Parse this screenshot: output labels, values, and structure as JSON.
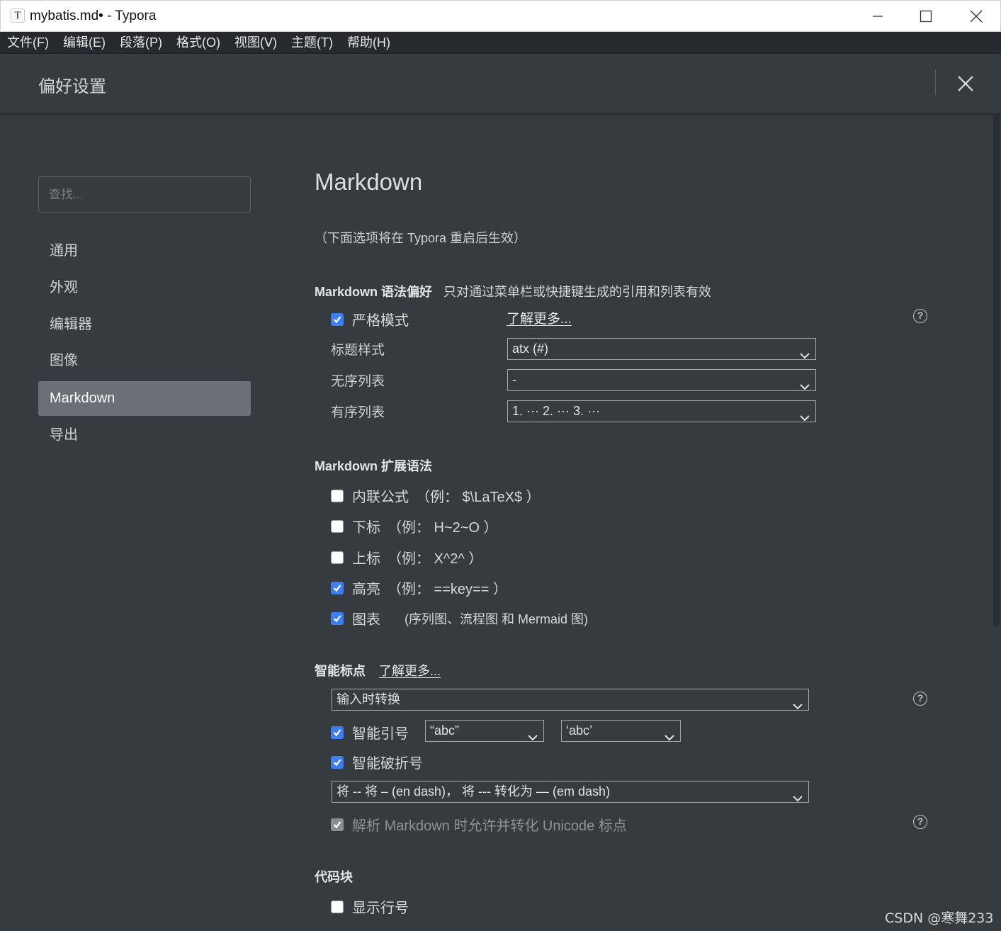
{
  "window": {
    "title": "mybatis.md• - Typora",
    "app_icon": "T"
  },
  "menu": [
    "文件(F)",
    "编辑(E)",
    "段落(P)",
    "格式(O)",
    "视图(V)",
    "主题(T)",
    "帮助(H)"
  ],
  "prefs": {
    "title": "偏好设置"
  },
  "sidebar": {
    "search_placeholder": "查找...",
    "items": [
      "通用",
      "外观",
      "编辑器",
      "图像",
      "Markdown",
      "导出"
    ],
    "active": "Markdown"
  },
  "main": {
    "title": "Markdown",
    "restart_note": "（下面选项将在 Typora 重启后生效）",
    "syntax_pref": {
      "title": "Markdown 语法偏好",
      "desc": "只对通过菜单栏或快捷键生成的引用和列表有效",
      "strict_mode": {
        "label": "严格模式",
        "checked": true
      },
      "learn_more": "了解更多...",
      "heading_style": {
        "label": "标题样式",
        "value": "atx (#)"
      },
      "unordered_list": {
        "label": "无序列表",
        "value": "-"
      },
      "ordered_list": {
        "label": "有序列表",
        "value": "1. ··· 2. ··· 3. ···"
      }
    },
    "ext_syntax": {
      "title": "Markdown 扩展语法",
      "items": [
        {
          "label": "内联公式",
          "example": "（例：  $\\LaTeX$ ）",
          "checked": false
        },
        {
          "label": "下标",
          "example": "（例：  H~2~O ）",
          "checked": false
        },
        {
          "label": "上标",
          "example": "（例：  X^2^ ）",
          "checked": false
        },
        {
          "label": "高亮",
          "example": "（例：  ==key== ）",
          "checked": true
        },
        {
          "label": "图表",
          "example": "(序列图、流程图 和 Mermaid 图)",
          "checked": true
        }
      ]
    },
    "smart_punct": {
      "title": "智能标点",
      "learn_more": "了解更多...",
      "mode": "输入时转换",
      "smart_quotes": {
        "label": "智能引号",
        "checked": true,
        "double": "“abc”",
        "single": "‘abc’"
      },
      "smart_dash": {
        "label": "智能破折号",
        "checked": true,
        "value": "将 -- 将 – (en dash)， 将 --- 转化为 — (em dash)"
      },
      "unicode": {
        "label": "解析 Markdown 时允许并转化 Unicode 标点",
        "checked": true,
        "disabled": true
      }
    },
    "code_block": {
      "title": "代码块",
      "show_line_numbers": {
        "label": "显示行号",
        "checked": false
      }
    }
  },
  "watermark": "CSDN @寒舞233",
  "help_glyph": "?",
  "icons": {
    "checkbox_checked": "checkmark-icon",
    "dropdown": "chevron-down-icon",
    "close": "close-icon",
    "help": "help-circle-icon"
  }
}
